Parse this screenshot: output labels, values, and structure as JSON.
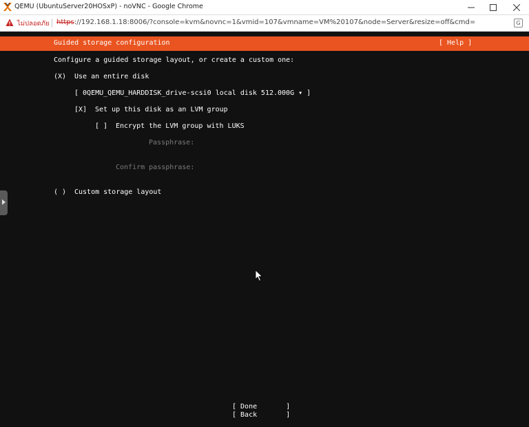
{
  "window": {
    "title": "QEMU (UbuntuServer20HOSxP) - noVNC - Google Chrome"
  },
  "addressbar": {
    "security_label": "ไม่ปลอดภัย",
    "url_scheme": "https",
    "url_rest": "://192.168.1.18:8006/?console=kvm&novnc=1&vmid=107&vmname=VM%20107&node=Server&resize=off&cmd="
  },
  "installer": {
    "header_title": "Guided storage configuration",
    "help_label": "[ Help ]",
    "intro": "Configure a guided storage layout, or create a custom one:",
    "entire_disk_radio": "(X)",
    "entire_disk_label": "Use an entire disk",
    "disk_select": "[ 0QEMU_QEMU_HARDDISK_drive-scsi0 local disk 512.000G ▾ ]",
    "lvm_checkbox": "[X]",
    "lvm_label": "Set up this disk as an LVM group",
    "encrypt_checkbox": "[ ]",
    "encrypt_label": "Encrypt the LVM group with LUKS",
    "passphrase_label": "Passphrase:",
    "confirm_passphrase_label": "Confirm passphrase:",
    "custom_radio": "( )",
    "custom_label": "Custom storage layout",
    "done_button": "[ Done       ]",
    "back_button": "[ Back       ]"
  },
  "colors": {
    "header_orange": "#e95420",
    "console_bg": "#111111"
  },
  "icons": {
    "app": "proxmox-x-icon",
    "warning": "warning-triangle-icon",
    "translate": "translate-icon",
    "side_handle": "chevron-right-icon",
    "cursor": "mouse-pointer-icon"
  }
}
